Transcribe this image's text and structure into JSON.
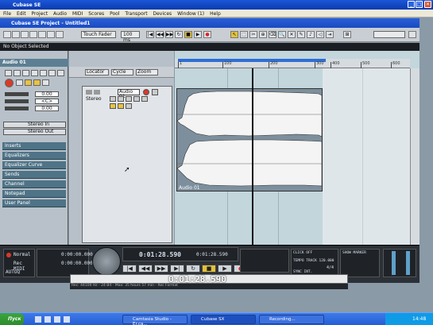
{
  "window": {
    "title": "Cubase SE",
    "minimize": "_",
    "maximize": "□",
    "close": "✕"
  },
  "menu": [
    "File",
    "Edit",
    "Project",
    "Audio",
    "MIDI",
    "Scores",
    "Pool",
    "Transport",
    "Devices",
    "Window (1)",
    "Help"
  ],
  "project": {
    "title": "Cubase SE Project - Untitled1"
  },
  "toolbar": {
    "touch_fader": "Touch Fader",
    "snap": "100 ms"
  },
  "statusline": {
    "text": "No Object Selected"
  },
  "inspector": {
    "track_name": "Audio 01",
    "volume": "0.00",
    "pan": "<C>",
    "delay": "0.00",
    "input": "Stereo In",
    "output": "Stereo Out",
    "sections": [
      "Inserts",
      "Equalizers",
      "Equalizer Curve",
      "Sends",
      "Channel",
      "Notepad",
      "User Panel"
    ]
  },
  "tracklist": {
    "locator": "Locator",
    "cycle": "Cycle",
    "zoom": "Zoom"
  },
  "track": {
    "name": "Audio 01",
    "mode": "Stereo"
  },
  "ruler": {
    "marks": [
      "1",
      "100",
      "200",
      "300",
      "400",
      "500",
      "600"
    ]
  },
  "event": {
    "name": "Audio 01"
  },
  "transport": {
    "mode_normal": "Normal",
    "mode_merge": "Rec MIDI",
    "auto": "AUTOQ",
    "punch_left": "0:00:00.000",
    "punch_right": "0:00:00.000",
    "main_time": "0:01:28.590",
    "secondary_time": "0:01:28.590",
    "click": "CLICK OFF",
    "tempo": "TEMPO TRACK 120.000",
    "sync": "SYNC INT.",
    "signature": "4/4",
    "show": "SHOW MARKER",
    "big_time": "0:01:28.590"
  },
  "statusbar2": {
    "text": "Rec: 44100 Hz - 24 Bit - Max: 35 hours 57 min - Rec Format"
  },
  "taskbar": {
    "start": "Пуск",
    "tasks": [
      "Camtasia Studio - Er.ca...",
      "Cubase SX",
      "Recording..."
    ],
    "clock": "14:48"
  },
  "colors": {
    "accent": "#e2c23a",
    "titlebar": "#1c56d8",
    "record": "#d83a2a",
    "locator": "#2d6fd4"
  }
}
